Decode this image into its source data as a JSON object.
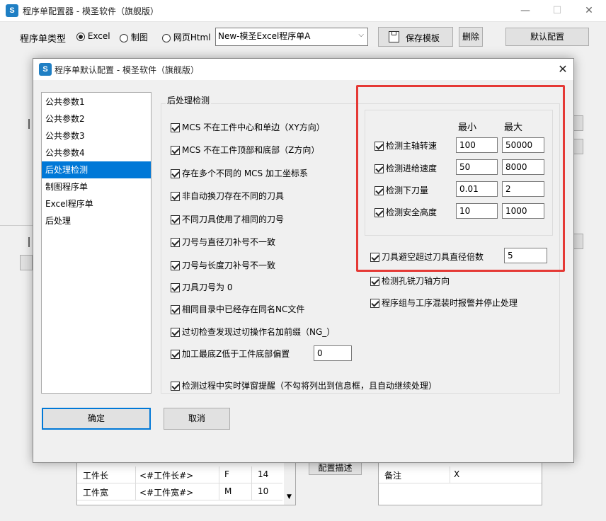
{
  "main_window": {
    "title": "程序单配置器 - 模圣软件（旗舰版）",
    "controls": {
      "minimize": "—",
      "maximize": "☐",
      "close": "✕"
    },
    "type_label": "程序单类型",
    "type_options": [
      {
        "label": "Excel",
        "selected": true
      },
      {
        "label": "制图",
        "selected": false
      },
      {
        "label": "网页Html",
        "selected": false
      }
    ],
    "template_select": "New-模圣Excel程序单A",
    "save_template_button": "保存模板",
    "delete_button": "删除",
    "default_config_button": "默认配置",
    "bottom_left_grid": {
      "rows": [
        [
          "工件长",
          "<#工件长#>",
          "F",
          "14"
        ],
        [
          "工件宽",
          "<#工件宽#>",
          "M",
          "10"
        ]
      ]
    },
    "config_desc_button": "配置描述",
    "bottom_right_grid": {
      "rows": [
        [
          "备注",
          "X"
        ]
      ]
    }
  },
  "dialog": {
    "title": "程序单默认配置 - 模圣软件（旗舰版）",
    "close": "✕",
    "nav_items": [
      {
        "label": "公共参数1",
        "selected": false
      },
      {
        "label": "公共参数2",
        "selected": false
      },
      {
        "label": "公共参数3",
        "selected": false
      },
      {
        "label": "公共参数4",
        "selected": false
      },
      {
        "label": "后处理检测",
        "selected": true
      },
      {
        "label": "制图程序单",
        "selected": false
      },
      {
        "label": "Excel程序单",
        "selected": false
      },
      {
        "label": "后处理",
        "selected": false
      }
    ],
    "group_title": "后处理检测",
    "checks_left": [
      {
        "label": "MCS 不在工件中心和单边（XY方向）",
        "checked": true
      },
      {
        "label": "MCS 不在工件顶部和底部（Z方向）",
        "checked": true
      },
      {
        "label": "存在多个不同的 MCS 加工坐标系",
        "checked": true
      },
      {
        "label": "非自动换刀存在不同的刀具",
        "checked": true
      },
      {
        "label": "不同刀具使用了相同的刀号",
        "checked": true
      },
      {
        "label": "刀号与直径刀补号不一致",
        "checked": true
      },
      {
        "label": "刀号与长度刀补号不一致",
        "checked": true
      },
      {
        "label": "刀具刀号为 0",
        "checked": true
      },
      {
        "label": "相同目录中已经存在同名NC文件",
        "checked": true
      },
      {
        "label": "过切检查发现过切操作名加前缀（NG_）",
        "checked": true
      },
      {
        "label": "加工最底Z低于工件底部偏置",
        "checked": true,
        "value": "0"
      }
    ],
    "range_header_min": "最小",
    "range_header_max": "最大",
    "range_checks": [
      {
        "label": "检测主轴转速",
        "checked": true,
        "min": "100",
        "max": "50000"
      },
      {
        "label": "检测进给速度",
        "checked": true,
        "min": "50",
        "max": "8000"
      },
      {
        "label": "检测下刀量",
        "checked": true,
        "min": "0.01",
        "max": "2"
      },
      {
        "label": "检测安全高度",
        "checked": true,
        "min": "10",
        "max": "1000"
      }
    ],
    "tool_clearance": {
      "label": "刀具避空超过刀具直径倍数",
      "checked": true,
      "value": "5"
    },
    "checks_right": [
      {
        "label": "检测孔铣刀轴方向",
        "checked": true
      },
      {
        "label": "程序组与工序混装时报警并停止处理",
        "checked": true
      }
    ],
    "realtime_popup": {
      "label": "检测过程中实时弹窗提醒（不勾将列出到信息框，且自动继续处理）",
      "checked": true
    },
    "ok_button": "确定",
    "cancel_button": "取消"
  },
  "colors": {
    "highlight": "#e53935",
    "selection": "#0078d7",
    "icon_brand": "#1f7fc4"
  }
}
